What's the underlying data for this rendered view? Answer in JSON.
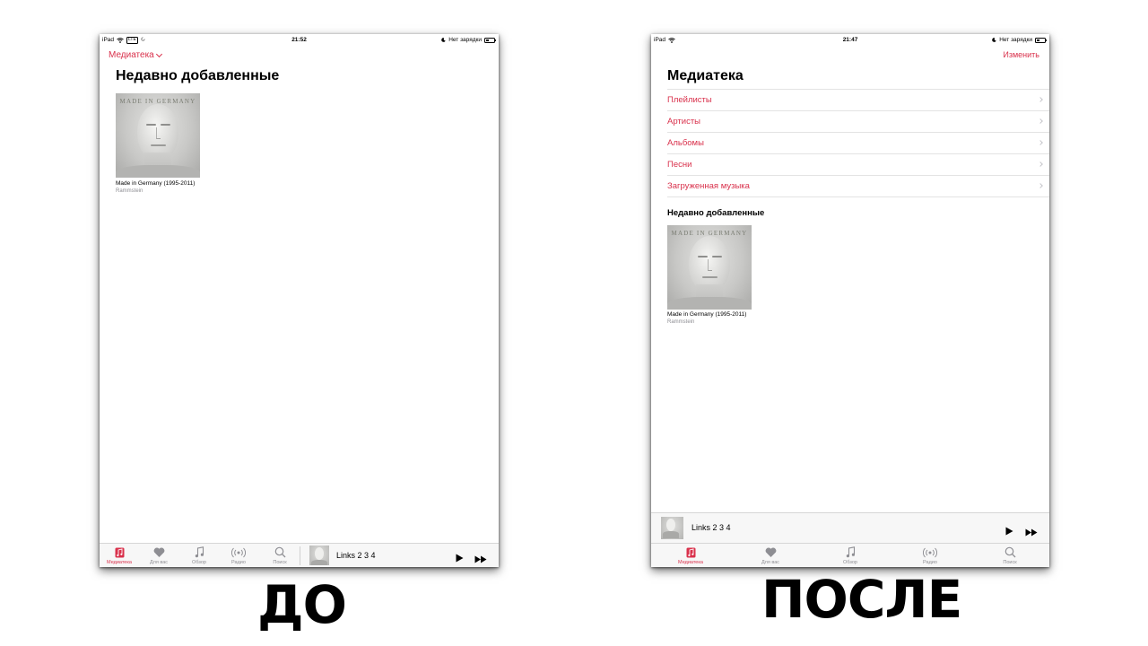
{
  "before": {
    "status": {
      "device": "iPad",
      "lte": "LTE",
      "time": "21:52",
      "battery_text": "Нет зарядки"
    },
    "library_dropdown": "Медиатека",
    "title": "Недавно добавленные",
    "album": {
      "art_text": "MADE IN GERMANY",
      "title": "Made in Germany (1995-2011)",
      "artist": "Rammstein"
    },
    "tabs": [
      {
        "label": "Медиатека",
        "icon": "music-library-icon",
        "active": true
      },
      {
        "label": "Для вас",
        "icon": "heart-icon"
      },
      {
        "label": "Обзор",
        "icon": "music-note-icon"
      },
      {
        "label": "Радио",
        "icon": "radio-icon"
      },
      {
        "label": "Поиск",
        "icon": "search-icon"
      }
    ],
    "now_playing": "Links 2 3 4"
  },
  "after": {
    "status": {
      "device": "iPad",
      "time": "21:47",
      "battery_text": "Нет зарядки"
    },
    "edit": "Изменить",
    "title": "Медиатека",
    "library_items": [
      "Плейлисты",
      "Артисты",
      "Альбомы",
      "Песни",
      "Загруженная музыка"
    ],
    "section_title": "Недавно добавленные",
    "album": {
      "art_text": "MADE IN GERMANY",
      "title": "Made in Germany (1995-2011)",
      "artist": "Rammstein"
    },
    "now_playing": "Links 2 3 4",
    "tabs": [
      {
        "label": "Медиатека",
        "icon": "music-library-icon",
        "active": true
      },
      {
        "label": "Для вас",
        "icon": "heart-icon"
      },
      {
        "label": "Обзор",
        "icon": "music-note-icon"
      },
      {
        "label": "Радио",
        "icon": "radio-icon"
      },
      {
        "label": "Поиск",
        "icon": "search-icon"
      }
    ]
  },
  "captions": {
    "before": "ДО",
    "after": "ПОСЛЕ"
  },
  "colors": {
    "accent": "#d9304b",
    "inactive": "#8e8e93",
    "bar_bg": "#f7f7f7"
  }
}
